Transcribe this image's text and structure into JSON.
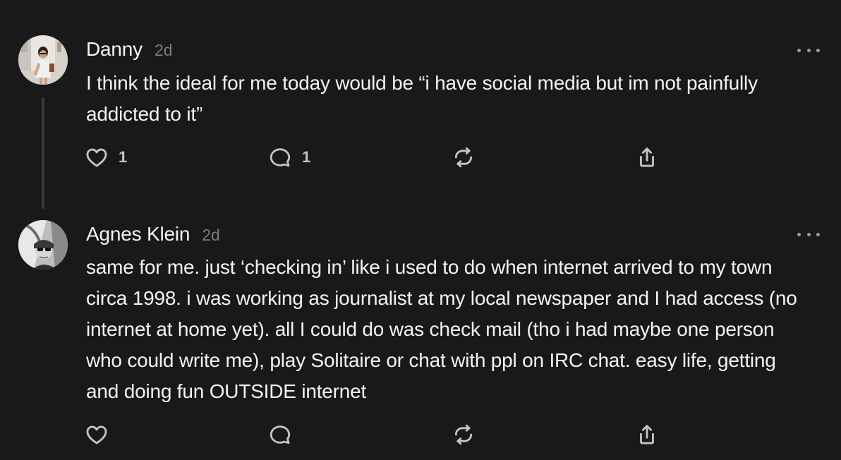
{
  "posts": [
    {
      "author": "Danny",
      "time": "2d",
      "text": "I think the ideal for me today would be “i have social media but im not painfully addicted to it”",
      "likes": "1",
      "comments": "1",
      "avatar": "photo-of-woman-avatar"
    },
    {
      "author": "Agnes Klein",
      "time": "2d",
      "text": "same for me. just ‘checking in’ like i used to do when internet arrived to my town circa 1998. i was working as journalist at my local newspaper and I had access (no internet at home yet). all I could do was check mail (tho i had maybe one person who could write me), play Solitaire or chat with ppl on IRC chat. easy life, getting and doing fun OUTSIDE internet",
      "avatar": "black-and-white-photo-avatar"
    }
  ],
  "icons": {
    "like": "heart-icon",
    "comment": "comment-bubble-icon",
    "repost": "repost-icon",
    "share": "share-icon",
    "more": "more-dots-icon"
  },
  "colors": {
    "background": "#19191b",
    "text": "#f3f3f3",
    "muted": "#7a7a7e",
    "icon": "#c4c4c7"
  }
}
